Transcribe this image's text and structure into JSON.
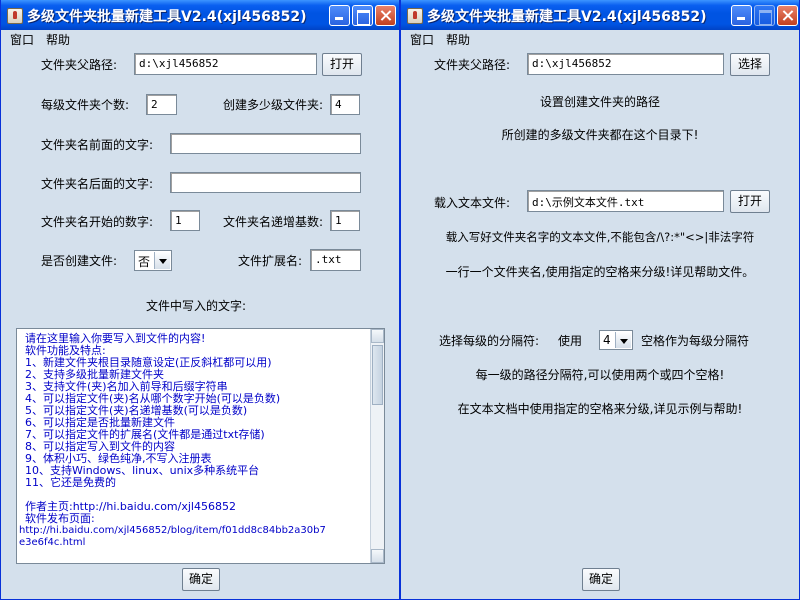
{
  "left": {
    "title": "多级文件夹批量新建工具V2.4(xjl456852)",
    "menu": [
      "窗口",
      "帮助"
    ],
    "folder_parent_label": "文件夹父路径:",
    "folder_parent_value": "d:\\xjl456852",
    "open_button": "打开",
    "per_level_count_label": "每级文件夹个数:",
    "per_level_count_value": "2",
    "levels_label": "创建多少级文件夹:",
    "levels_value": "4",
    "prefix_label": "文件夹名前面的文字:",
    "prefix_value": "",
    "suffix_label": "文件夹名后面的文字:",
    "suffix_value": "",
    "start_num_label": "文件夹名开始的数字:",
    "start_num_value": "1",
    "increment_label": "文件夹名递增基数:",
    "increment_value": "1",
    "create_file_label": "是否创建文件:",
    "create_file_value": "否",
    "ext_label": "文件扩展名:",
    "ext_value": ".txt",
    "content_label": "文件中写入的文字:",
    "content_lines": [
      "请在这里输入你要写入到文件的内容!",
      "软件功能及特点:",
      "1、新建文件夹根目录随意设定(正反斜杠都可以用)",
      "2、支持多级批量新建文件夹",
      "3、支持文件(夹)名加入前导和后缀字符串",
      "4、可以指定文件(夹)名从哪个数字开始(可以是负数)",
      "5、可以指定文件(夹)名递增基数(可以是负数)",
      "6、可以指定是否批量新建文件",
      "7、可以指定文件的扩展名(文件都是通过txt存储)",
      "8、可以指定写入到文件的内容",
      "9、体积小巧、绿色纯净,不写入注册表",
      "10、支持Windows、linux、unix多种系统平台",
      "11、它还是免费的",
      "",
      "作者主页:http://hi.baidu.com/xjl456852",
      "软件发布页面:",
      "http://hi.baidu.com/xjl456852/blog/item/f01dd8c84bb2a30b7",
      "e3e6f4c.html"
    ],
    "ok_button": "确定"
  },
  "right": {
    "title": "多级文件夹批量新建工具V2.4(xjl456852)",
    "menu": [
      "窗口",
      "帮助"
    ],
    "folder_parent_label": "文件夹父路径:",
    "folder_parent_value": "d:\\xjl456852",
    "choose_button": "选择",
    "info1": "设置创建文件夹的路径",
    "info2": "所创建的多级文件夹都在这个目录下!",
    "load_text_label": "载入文本文件:",
    "load_text_value": "d:\\示例文本文件.txt",
    "open_button": "打开",
    "info3": "载入写好文件夹名字的文本文件,不能包含/\\?:*\"<>|非法字符",
    "info4": "一行一个文件夹名,使用指定的空格来分级!详见帮助文件。",
    "sep_label": "选择每级的分隔符:",
    "use_label": "使用",
    "sep_value": "4",
    "sep_suffix": "空格作为每级分隔符",
    "info5": "每一级的路径分隔符,可以使用两个或四个空格!",
    "info6": "在文本文档中使用指定的空格来分级,详见示例与帮助!",
    "ok_button": "确定"
  }
}
